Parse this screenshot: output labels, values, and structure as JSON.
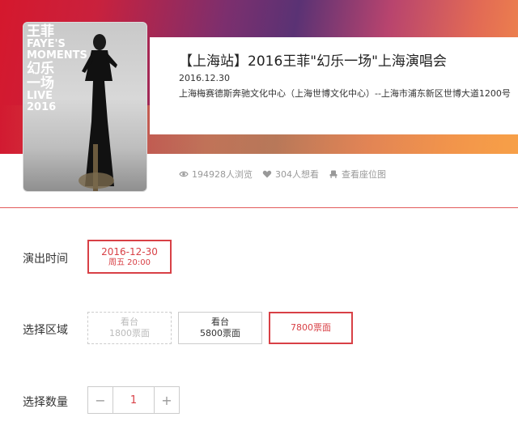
{
  "event": {
    "title": "【上海站】2016王菲\"幻乐一场\"上海演唱会",
    "date": "2016.12.30",
    "venue": "上海梅赛德斯奔驰文化中心（上海世博文化中心）--上海市浦东新区世博大道1200号"
  },
  "poster": {
    "text_lines": [
      "王菲",
      "FAYE'S",
      "MOMENTS",
      "幻乐",
      "一场",
      "LIVE",
      "2016"
    ]
  },
  "stats": {
    "views": "194928人浏览",
    "wants": "304人想看",
    "seatmap": "查看座位图"
  },
  "showtime": {
    "label": "演出时间",
    "options": [
      {
        "date": "2016-12-30",
        "time": "周五 20:00",
        "state": "selected"
      }
    ]
  },
  "zone": {
    "label": "选择区域",
    "options": [
      {
        "line1": "看台",
        "line2": "1800票面",
        "state": "disabled"
      },
      {
        "line1": "看台",
        "line2": "5800票面",
        "state": "normal"
      },
      {
        "line1": "7800票面",
        "line2": "",
        "state": "selected"
      }
    ]
  },
  "quantity": {
    "label": "选择数量",
    "minus": "−",
    "value": "1",
    "plus": "+"
  },
  "colors": {
    "accent": "#d84046",
    "muted": "#999999"
  },
  "icons": [
    "eye-icon",
    "heart-icon",
    "seat-icon"
  ]
}
